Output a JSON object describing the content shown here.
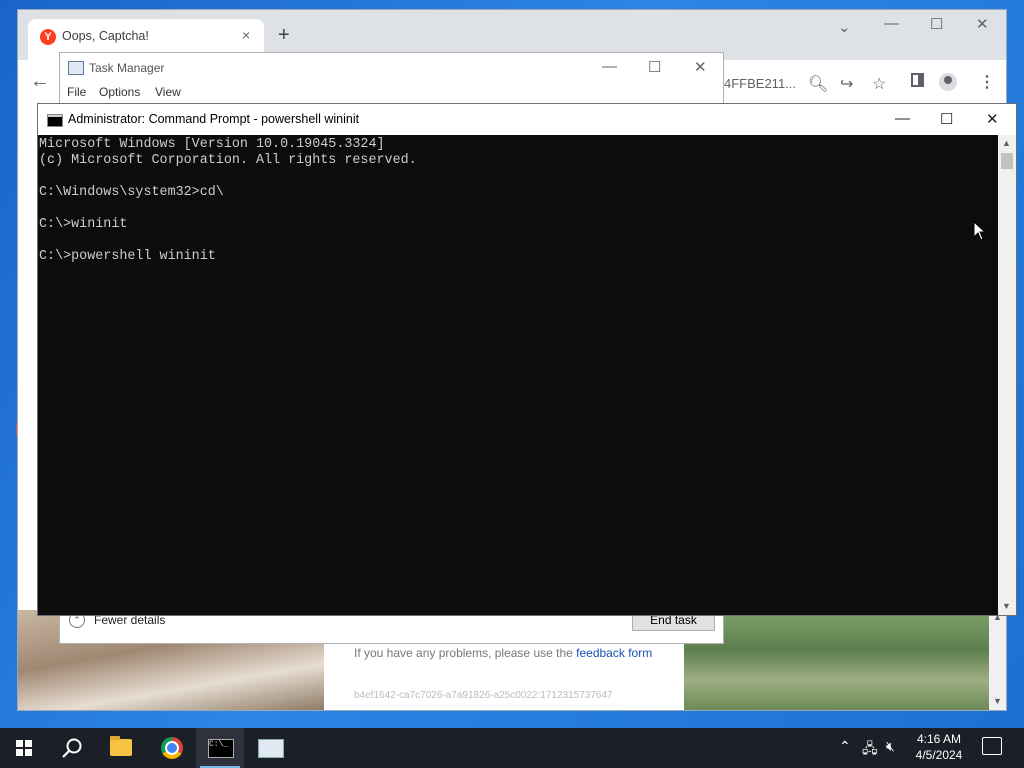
{
  "browser": {
    "tab_title": "Oops, Captcha!",
    "tab_close": "×",
    "new_tab": "+",
    "url_fragment": "4FFBE211...",
    "window_controls": {
      "minimize": "—",
      "maximize": "☐",
      "close": "✕",
      "dropdown": "⌄"
    },
    "back": "←",
    "page": {
      "feedback_prefix": "If you have any problems, please use the",
      "feedback_link": "feedback form",
      "hash_text": "b4ef1642-ca7c7026-a7a91826-a25c0022:1712315737647"
    },
    "icons": [
      "search-icon",
      "share-icon",
      "star-icon",
      "sidebar-icon",
      "profile-icon",
      "menu-icon"
    ]
  },
  "task_manager": {
    "title": "Task Manager",
    "menu": [
      "File",
      "Options",
      "View"
    ],
    "fewer_details": "Fewer details",
    "end_task": "End task",
    "controls": {
      "minimize": "—",
      "maximize": "☐",
      "close": "✕"
    }
  },
  "cmd": {
    "title": "Administrator: Command Prompt - powershell  wininit",
    "controls": {
      "minimize": "—",
      "maximize": "☐",
      "close": "✕"
    },
    "console_lines": [
      "Microsoft Windows [Version 10.0.19045.3324]",
      "(c) Microsoft Corporation. All rights reserved.",
      "",
      "C:\\Windows\\system32>cd\\",
      "",
      "C:\\>wininit",
      "",
      "C:\\>powershell wininit"
    ]
  },
  "taskbar": {
    "apps": [
      "start-button",
      "search-button",
      "file-explorer",
      "chrome",
      "command-prompt",
      "task-manager"
    ],
    "active_app": "command-prompt",
    "time": "4:16 AM",
    "date": "4/5/2024"
  },
  "colors": {
    "console_bg": "#0c0c0c",
    "console_fg": "#cccccc",
    "taskbar_bg": "#1b1f27",
    "desktop_blue": "#1d6fd0",
    "link_blue": "#1a4fb8"
  }
}
